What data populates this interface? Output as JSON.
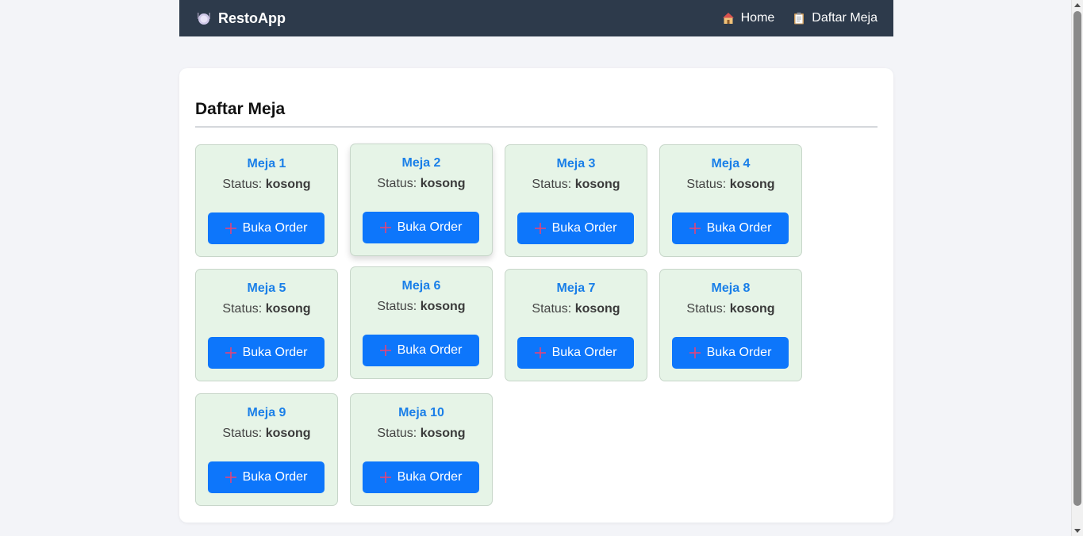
{
  "navbar": {
    "brand_icon": "plate-icon",
    "brand": "RestoApp",
    "links": [
      {
        "icon": "house-icon",
        "label": "Home"
      },
      {
        "icon": "clipboard-icon",
        "label": "Daftar Meja"
      }
    ]
  },
  "main": {
    "title": "Daftar Meja",
    "status_label": "Status:",
    "order_button_label": "Buka Order",
    "tables": [
      {
        "name": "Meja 1",
        "status": "kosong"
      },
      {
        "name": "Meja 2",
        "status": "kosong"
      },
      {
        "name": "Meja 3",
        "status": "kosong"
      },
      {
        "name": "Meja 4",
        "status": "kosong"
      },
      {
        "name": "Meja 5",
        "status": "kosong"
      },
      {
        "name": "Meja 6",
        "status": "kosong"
      },
      {
        "name": "Meja 7",
        "status": "kosong"
      },
      {
        "name": "Meja 8",
        "status": "kosong"
      },
      {
        "name": "Meja 9",
        "status": "kosong"
      },
      {
        "name": "Meja 10",
        "status": "kosong"
      }
    ]
  },
  "colors": {
    "navbar_bg": "#2d3a4b",
    "card_bg": "#e6f4e7",
    "accent": "#0d76fb",
    "table_name": "#1a7fe8",
    "plus_icon": "#e0457b"
  }
}
